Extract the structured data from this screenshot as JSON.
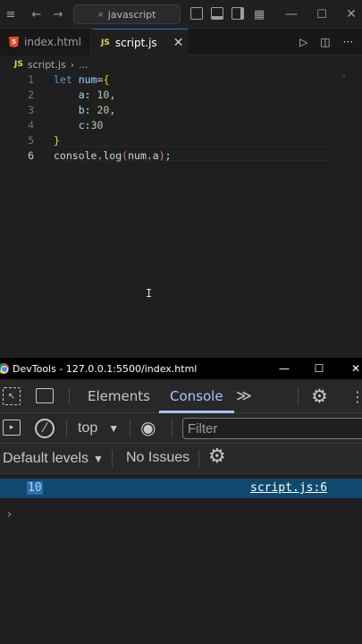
{
  "titlebar": {
    "search_text": "javascript",
    "icons": [
      "back-arrow-icon",
      "forward-arrow-icon",
      "search-icon",
      "layout-sidebar-icon",
      "layout-panel-icon",
      "layout-secondary-icon",
      "layout-customize-icon",
      "minimize-icon",
      "maximize-icon",
      "close-icon"
    ]
  },
  "tabs": [
    {
      "label": "index.html",
      "icon": "html5-icon",
      "active": false
    },
    {
      "label": "script.js",
      "icon": "js-icon",
      "active": true
    }
  ],
  "breadcrumb": {
    "file": "script.js",
    "rest": "..."
  },
  "editor": {
    "lines": [
      {
        "no": "1",
        "code": "let num={"
      },
      {
        "no": "2",
        "code": "    a: 10,"
      },
      {
        "no": "3",
        "code": "    b: 20,"
      },
      {
        "no": "4",
        "code": "    c:30"
      },
      {
        "no": "5",
        "code": "}"
      },
      {
        "no": "6",
        "code": "console.log(num.a);"
      }
    ],
    "current_line": 6
  },
  "devtools": {
    "window_title": "DevTools - 127.0.0.1:5500/index.html",
    "tabs": {
      "elements": "Elements",
      "console": "Console"
    },
    "context": "top",
    "filter_placeholder": "Filter",
    "levels": "Default levels",
    "issues": "No Issues",
    "log": {
      "value": "10",
      "source": "script.js:6"
    },
    "prompt": "›"
  },
  "colors": {
    "accent": "#0078d4",
    "devtools_accent": "#a8c7fa",
    "log_highlight": "#0f4a6e"
  }
}
